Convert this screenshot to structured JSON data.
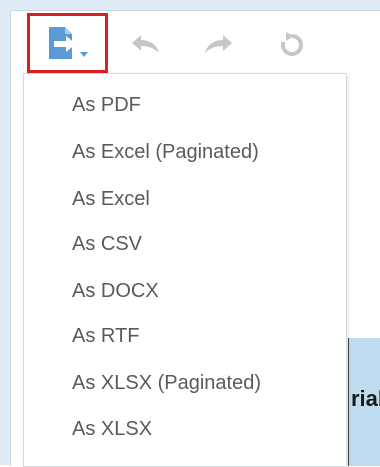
{
  "toolbar": {
    "export_icon": "export-document-icon",
    "undo_icon": "undo-arrow-icon",
    "redo_icon": "redo-arrow-icon",
    "reset_icon": "reset-refresh-icon",
    "highlight_color": "#d81f26",
    "icon_color": "#5b9bd5",
    "disabled_icon_color": "#c4c8cc"
  },
  "export_menu": {
    "items": [
      {
        "label": "As PDF"
      },
      {
        "label": "As Excel (Paginated)"
      },
      {
        "label": "As Excel"
      },
      {
        "label": "As CSV"
      },
      {
        "label": "As DOCX"
      },
      {
        "label": "As RTF"
      },
      {
        "label": "As XLSX (Paginated)"
      },
      {
        "label": "As XLSX"
      }
    ]
  },
  "background": {
    "partial_text": "rial",
    "header_color": "#c0dcf0"
  }
}
